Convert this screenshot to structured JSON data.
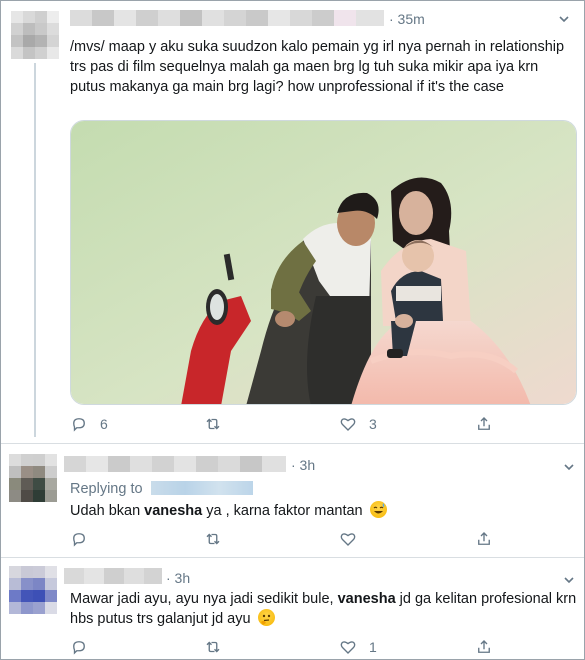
{
  "tweets": [
    {
      "time": "· 35m",
      "text": "/mvs/ maap y aku suka suudzon kalo pemain yg irl nya pernah in relationship trs pas di film sequelnya malah ga maen brg lg tuh suka mikir apa iya krn putus makanya ga main brg lagi? how unprofessional if it's the case",
      "replies_count": "6",
      "retweets_count": "",
      "likes_count": "3",
      "has_photo": true
    },
    {
      "time": "· 3h",
      "replying_to_label": "Replying to",
      "text_before": "Udah bkan ",
      "text_bold": "vanesha",
      "text_after": " ya , karna faktor mantan ",
      "emoji": "grinning-sweat-emoji",
      "replies_count": "",
      "likes_count": ""
    },
    {
      "time": "· 3h",
      "text_before": "Mawar jadi ayu, ayu nya jadi sedikit bule, ",
      "text_bold": "vanesha",
      "text_after": " jd ga kelitan profesional krn hbs putus trs galanjut jd ayu ",
      "emoji": "thinking-face-emoji",
      "replies_count": "",
      "likes_count": "1"
    }
  ],
  "colors": {
    "meta": "#657786",
    "text": "#14171a",
    "divider": "#d9dee2",
    "photo_bg": "#cfe2bf"
  },
  "icons": [
    "reply-icon",
    "retweet-icon",
    "like-icon",
    "share-icon",
    "chevron-down-icon"
  ]
}
